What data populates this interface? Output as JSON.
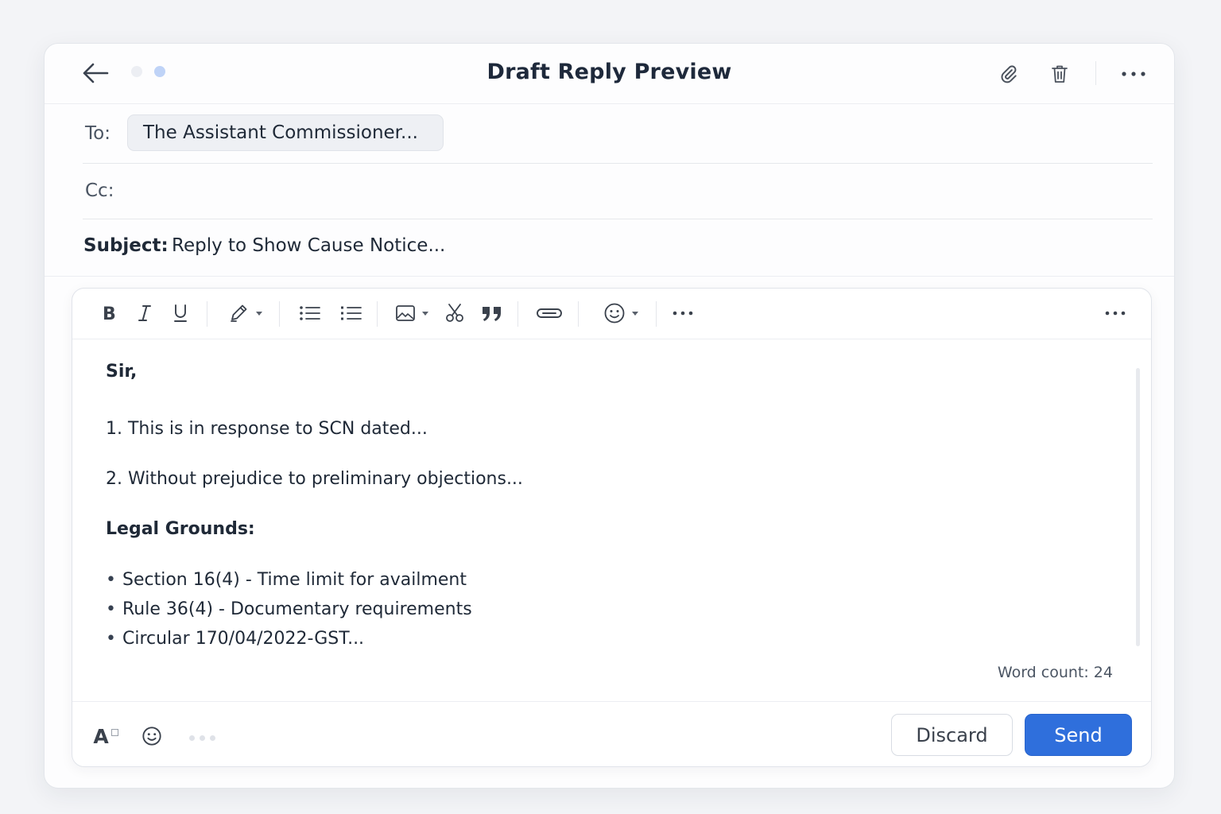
{
  "header": {
    "title": "Draft Reply Preview",
    "back_icon": "arrow-left-icon",
    "attach_icon": "paperclip-icon",
    "delete_icon": "trash-icon",
    "more_icon": "more-horizontal-icon"
  },
  "fields": {
    "to_label": "To:",
    "to_value": "The Assistant Commissioner...",
    "cc_label": "Cc:",
    "cc_value": "",
    "subject_label": "Subject:",
    "subject_value": "Reply to Show Cause Notice..."
  },
  "toolbar": {
    "items": [
      "bold-icon",
      "italic-icon",
      "underline-icon",
      "highlight-pen-icon",
      "bulleted-list-icon",
      "numbered-list-icon",
      "image-icon",
      "cut-icon",
      "quote-icon",
      "link-icon",
      "emoji-icon",
      "more-icon",
      "overflow-more-icon"
    ]
  },
  "body": {
    "salutation": "Sir,",
    "paragraph_1": "1. This is in response to SCN dated...",
    "paragraph_2": "2. Without prejudice to preliminary objections...",
    "grounds_heading": "Legal Grounds:",
    "grounds": [
      "Section 16(4) - Time limit for availment",
      "Rule 36(4) - Documentary requirements",
      "Circular 170/04/2022-GST..."
    ]
  },
  "footer": {
    "word_count": "Word count: 24",
    "font_format_label": "A",
    "discard_label": "Discard",
    "send_label": "Send"
  },
  "colors": {
    "accent": "#2f6fdc",
    "background": "#f3f4f7",
    "text": "#1f2937"
  }
}
